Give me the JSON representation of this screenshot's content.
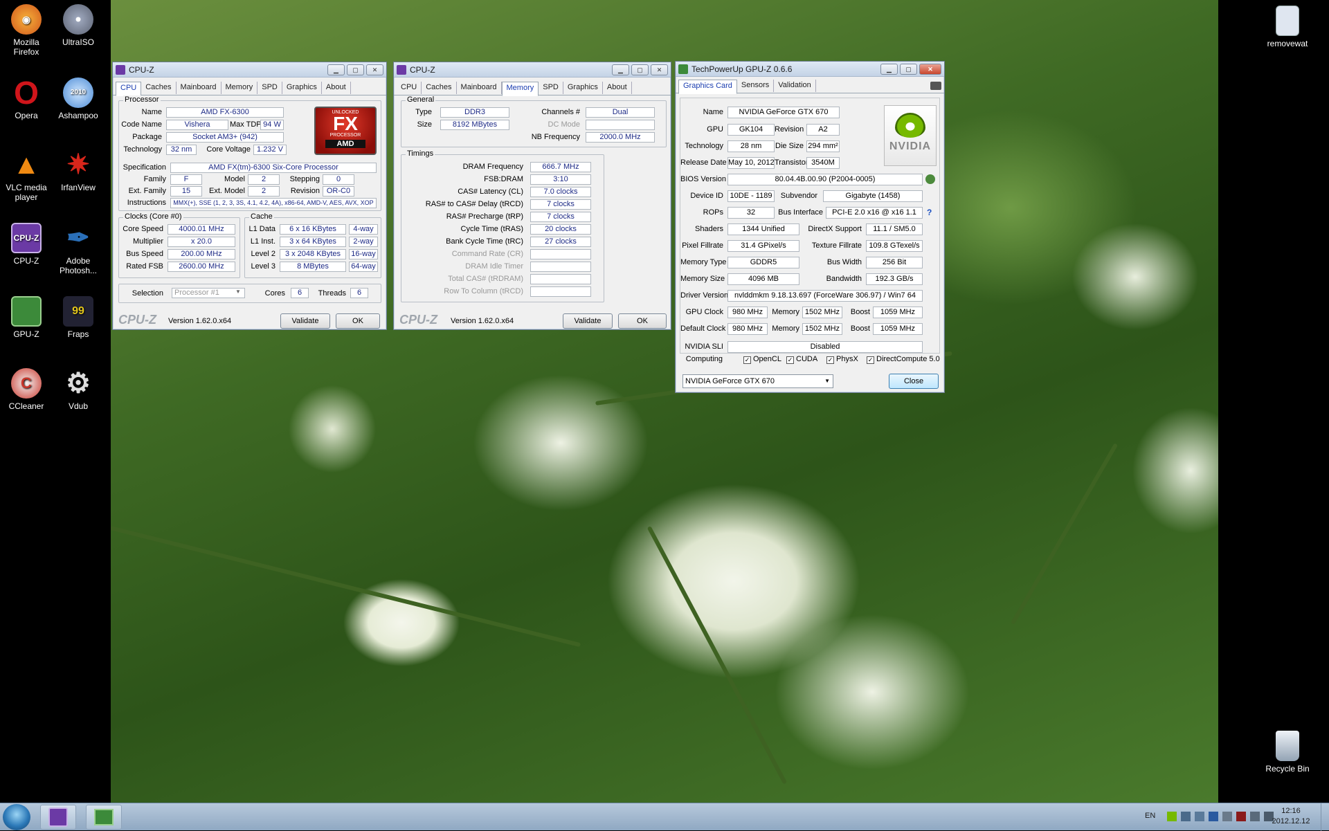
{
  "desktop": {
    "icons": [
      {
        "label": "Mozilla Firefox",
        "icon": "firefox-icon",
        "color": "#e0731d"
      },
      {
        "label": "UltraISO",
        "icon": "disc-icon",
        "color": "#9aa3b8"
      },
      {
        "label": "Opera",
        "icon": "opera-icon",
        "color": "#cc1a1a"
      },
      {
        "label": "Ashampoo",
        "icon": "ashampoo-icon",
        "color": "#4a8ad4"
      },
      {
        "label": "VLC media player",
        "icon": "vlc-cone-icon",
        "color": "#f08a12"
      },
      {
        "label": "IrfanView",
        "icon": "irfanview-icon",
        "color": "#d8261b"
      },
      {
        "label": "CPU-Z",
        "icon": "cpuz-icon",
        "color": "#6b3aa5"
      },
      {
        "label": "Adobe Photosh...",
        "icon": "feather-icon",
        "color": "#2a6fb8"
      },
      {
        "label": "GPU-Z",
        "icon": "gpu-card-icon",
        "color": "#3c8a3a"
      },
      {
        "label": "Fraps",
        "icon": "fraps-icon",
        "color": "#e3c61a"
      },
      {
        "label": "CCleaner",
        "icon": "ccleaner-icon",
        "color": "#c8352a"
      },
      {
        "label": "Vdub",
        "icon": "gear-icon",
        "color": "#777777"
      },
      {
        "label": "removewat",
        "icon": "file-icon",
        "color": "#dfe6f0"
      },
      {
        "label": "Recycle Bin",
        "icon": "recycle-bin-icon",
        "color": "#b8c4d0"
      }
    ]
  },
  "cpuz1": {
    "title": "CPU-Z",
    "tabs": [
      "CPU",
      "Caches",
      "Mainboard",
      "Memory",
      "SPD",
      "Graphics",
      "About"
    ],
    "active_tab": "CPU",
    "processor": {
      "group": "Processor",
      "name_label": "Name",
      "name": "AMD FX-6300",
      "codename_label": "Code Name",
      "codename": "Vishera",
      "maxtdp_label": "Max TDP",
      "maxtdp": "94 W",
      "package_label": "Package",
      "package": "Socket AM3+ (942)",
      "technology_label": "Technology",
      "technology": "32 nm",
      "corevoltage_label": "Core Voltage",
      "corevoltage": "1.232 V",
      "spec_label": "Specification",
      "spec": "AMD FX(tm)-6300 Six-Core Processor",
      "family_label": "Family",
      "family": "F",
      "model_label": "Model",
      "model": "2",
      "stepping_label": "Stepping",
      "stepping": "0",
      "extfamily_label": "Ext. Family",
      "extfamily": "15",
      "extmodel_label": "Ext. Model",
      "extmodel": "2",
      "revision_label": "Revision",
      "revision": "OR-C0",
      "instructions_label": "Instructions",
      "instructions": "MMX(+), SSE (1, 2, 3, 3S, 4.1, 4.2, 4A), x86-64, AMD-V, AES, AVX, XOP",
      "logo_top": "UNLOCKED",
      "logo_main": "FX",
      "logo_sub": "PROCESSOR",
      "logo_brand": "AMD"
    },
    "clocks": {
      "group": "Clocks (Core #0)",
      "corespeed_label": "Core Speed",
      "corespeed": "4000.01 MHz",
      "multiplier_label": "Multiplier",
      "multiplier": "x 20.0",
      "busspeed_label": "Bus Speed",
      "busspeed": "200.00 MHz",
      "ratedfsb_label": "Rated FSB",
      "ratedfsb": "2600.00 MHz"
    },
    "cache": {
      "group": "Cache",
      "l1d_label": "L1 Data",
      "l1d": "6 x 16 KBytes",
      "l1d_way": "4-way",
      "l1i_label": "L1 Inst.",
      "l1i": "3 x 64 KBytes",
      "l1i_way": "2-way",
      "l2_label": "Level 2",
      "l2": "3 x 2048 KBytes",
      "l2_way": "16-way",
      "l3_label": "Level 3",
      "l3": "8 MBytes",
      "l3_way": "64-way"
    },
    "selection_label": "Selection",
    "selection": "Processor #1",
    "cores_label": "Cores",
    "cores": "6",
    "threads_label": "Threads",
    "threads": "6",
    "footer_logo": "CPU-Z",
    "version": "Version 1.62.0.x64",
    "validate": "Validate",
    "ok": "OK"
  },
  "cpuz2": {
    "title": "CPU-Z",
    "tabs": [
      "CPU",
      "Caches",
      "Mainboard",
      "Memory",
      "SPD",
      "Graphics",
      "About"
    ],
    "active_tab": "Memory",
    "general": {
      "group": "General",
      "type_label": "Type",
      "type": "DDR3",
      "size_label": "Size",
      "size": "8192 MBytes",
      "channels_label": "Channels #",
      "channels": "Dual",
      "dcmode_label": "DC Mode",
      "dcmode": "",
      "nbfreq_label": "NB Frequency",
      "nbfreq": "2000.0 MHz"
    },
    "timings": {
      "group": "Timings",
      "rows": [
        {
          "label": "DRAM Frequency",
          "value": "666.7 MHz",
          "dim": false
        },
        {
          "label": "FSB:DRAM",
          "value": "3:10",
          "dim": false
        },
        {
          "label": "CAS# Latency (CL)",
          "value": "7.0 clocks",
          "dim": false
        },
        {
          "label": "RAS# to CAS# Delay (tRCD)",
          "value": "7 clocks",
          "dim": false
        },
        {
          "label": "RAS# Precharge (tRP)",
          "value": "7 clocks",
          "dim": false
        },
        {
          "label": "Cycle Time (tRAS)",
          "value": "20 clocks",
          "dim": false
        },
        {
          "label": "Bank Cycle Time (tRC)",
          "value": "27 clocks",
          "dim": false
        },
        {
          "label": "Command Rate (CR)",
          "value": "",
          "dim": true
        },
        {
          "label": "DRAM Idle Timer",
          "value": "",
          "dim": true
        },
        {
          "label": "Total CAS# (tRDRAM)",
          "value": "",
          "dim": true
        },
        {
          "label": "Row To Column (tRCD)",
          "value": "",
          "dim": true
        }
      ]
    },
    "footer_logo": "CPU-Z",
    "version": "Version 1.62.0.x64",
    "validate": "Validate",
    "ok": "OK"
  },
  "gpuz": {
    "title": "TechPowerUp GPU-Z 0.6.6",
    "tabs": [
      "Graphics Card",
      "Sensors",
      "Validation"
    ],
    "name_label": "Name",
    "name": "NVIDIA GeForce GTX 670",
    "gpu_label": "GPU",
    "gpu": "GK104",
    "revision_label": "Revision",
    "revision": "A2",
    "technology_label": "Technology",
    "technology": "28 nm",
    "diesize_label": "Die Size",
    "diesize": "294 mm²",
    "releasedate_label": "Release Date",
    "releasedate": "May 10, 2012",
    "transistors_label": "Transistors",
    "transistors": "3540M",
    "bios_label": "BIOS Version",
    "bios": "80.04.4B.00.90 (P2004-0005)",
    "deviceid_label": "Device ID",
    "deviceid": "10DE - 1189",
    "subvendor_label": "Subvendor",
    "subvendor": "Gigabyte (1458)",
    "rops_label": "ROPs",
    "rops": "32",
    "businterface_label": "Bus Interface",
    "businterface": "PCI-E 2.0 x16 @ x16 1.1",
    "shaders_label": "Shaders",
    "shaders": "1344 Unified",
    "directx_label": "DirectX Support",
    "directx": "11.1 / SM5.0",
    "pixelfill_label": "Pixel Fillrate",
    "pixelfill": "31.4 GPixel/s",
    "texfill_label": "Texture Fillrate",
    "texfill": "109.8 GTexel/s",
    "memtype_label": "Memory Type",
    "memtype": "GDDR5",
    "buswidth_label": "Bus Width",
    "buswidth": "256 Bit",
    "memsize_label": "Memory Size",
    "memsize": "4096 MB",
    "bandwidth_label": "Bandwidth",
    "bandwidth": "192.3 GB/s",
    "driver_label": "Driver Version",
    "driver": "nvlddmkm 9.18.13.697 (ForceWare 306.97) / Win7 64",
    "gpuclock_label": "GPU Clock",
    "gpuclock": "980 MHz",
    "memory_label": "Memory",
    "gpuclock_mem": "1502 MHz",
    "boost_label": "Boost",
    "gpuclock_boost": "1059 MHz",
    "defclock_label": "Default Clock",
    "defclock": "980 MHz",
    "defclock_mem": "1502 MHz",
    "defclock_boost": "1059 MHz",
    "sli_label": "NVIDIA SLI",
    "sli": "Disabled",
    "computing_label": "Computing",
    "computing": [
      "OpenCL",
      "CUDA",
      "PhysX",
      "DirectCompute 5.0"
    ],
    "help_glyph": "?",
    "logo_text": "NVIDIA",
    "card_select": "NVIDIA GeForce GTX 670",
    "close": "Close"
  },
  "taskbar": {
    "lang": "EN",
    "time": "12:16",
    "date": "2012.12.12"
  }
}
